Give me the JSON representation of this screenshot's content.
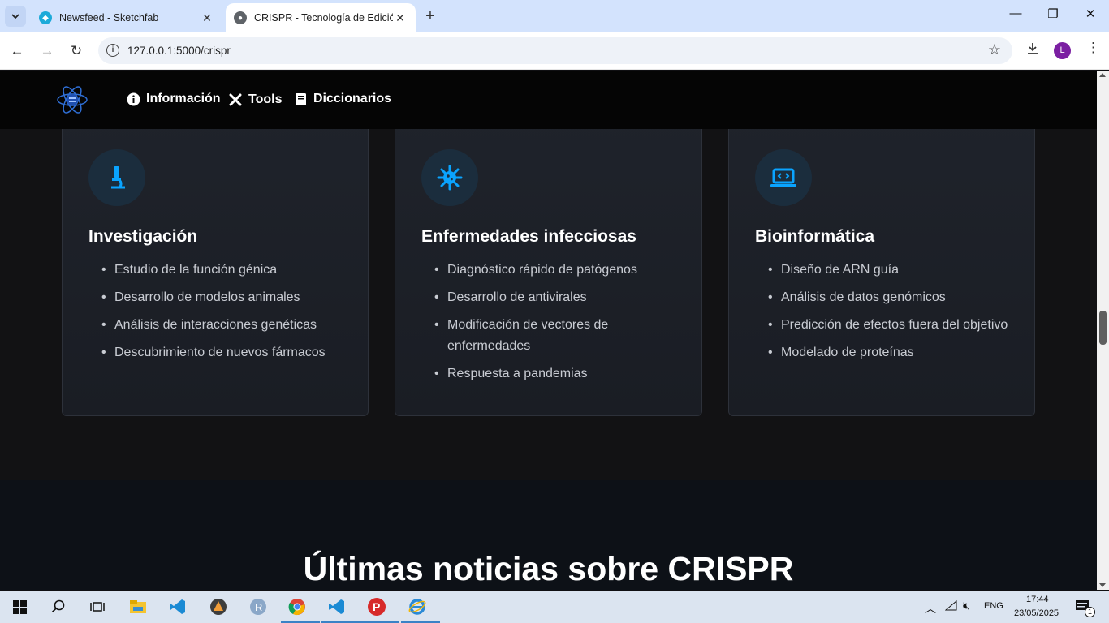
{
  "browser": {
    "tabs": [
      {
        "title": "Newsfeed - Sketchfab",
        "active": false
      },
      {
        "title": "CRISPR - Tecnología de Edición",
        "active": true
      }
    ],
    "url": "127.0.0.1:5000/crispr",
    "profile_initial": "L"
  },
  "site": {
    "nav": [
      {
        "label": "Información",
        "icon": "info-circle-icon"
      },
      {
        "label": "Tools",
        "icon": "tools-icon"
      },
      {
        "label": "Diccionarios",
        "icon": "book-icon"
      }
    ]
  },
  "cards": [
    {
      "title": "Investigación",
      "icon": "microscope-icon",
      "items": [
        "Estudio de la función génica",
        "Desarrollo de modelos animales",
        "Análisis de interacciones genéticas",
        "Descubrimiento de nuevos fármacos"
      ]
    },
    {
      "title": "Enfermedades infecciosas",
      "icon": "virus-icon",
      "items": [
        "Diagnóstico rápido de patógenos",
        "Desarrollo de antivirales",
        "Modificación de vectores de enfermedades",
        "Respuesta a pandemias"
      ]
    },
    {
      "title": "Bioinformática",
      "icon": "laptop-code-icon",
      "items": [
        "Diseño de ARN guía",
        "Análisis de datos genómicos",
        "Predicción de efectos fuera del objetivo",
        "Modelado de proteínas"
      ]
    }
  ],
  "news": {
    "title": "Últimas noticias sobre CRISPR"
  },
  "taskbar": {
    "language": "ENG",
    "time": "17:44",
    "date": "23/05/2025",
    "notifications": "1"
  },
  "colors": {
    "accent": "#0aa4ff",
    "nav_bg": "#050505",
    "card_bg": "#1f232b"
  }
}
